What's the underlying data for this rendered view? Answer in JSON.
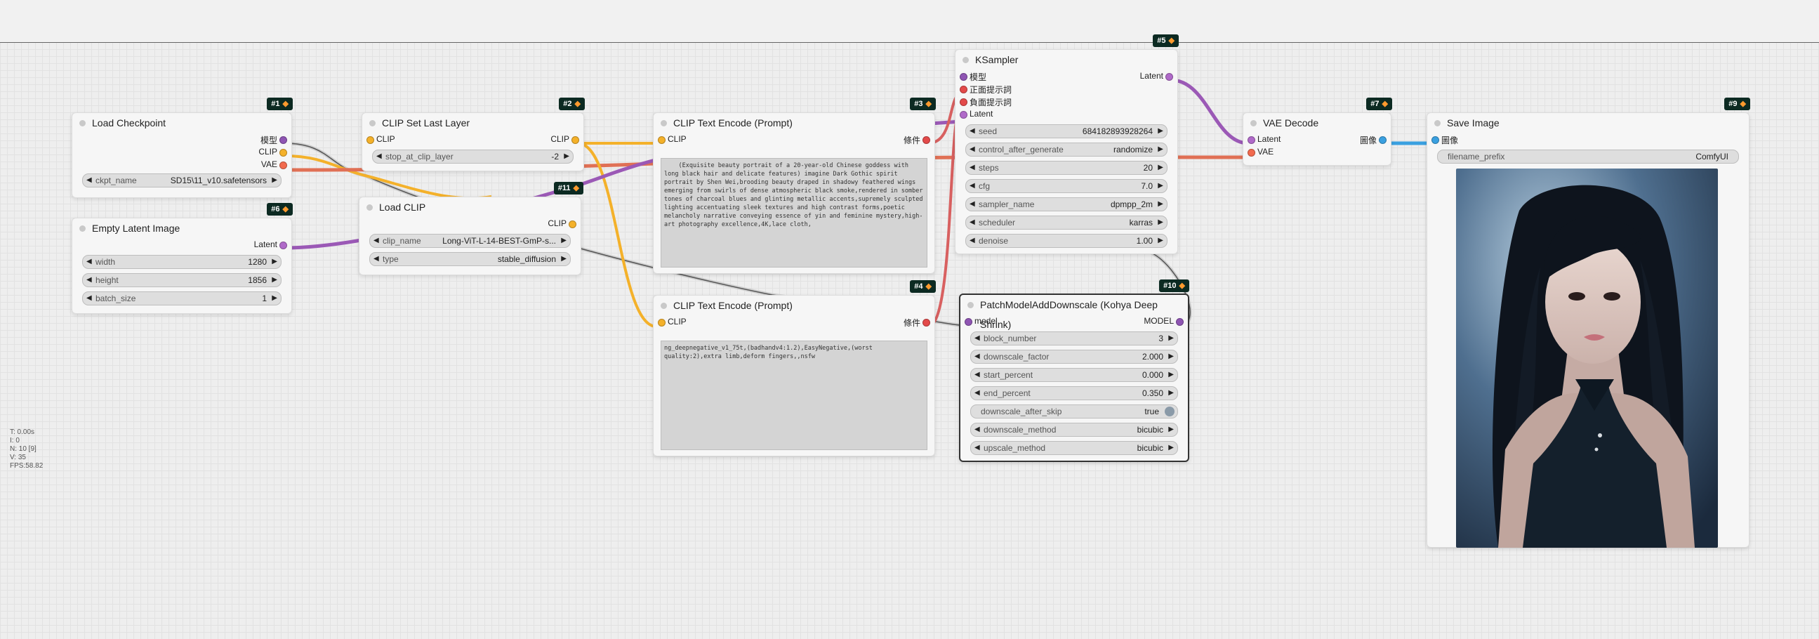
{
  "colors": {
    "model": "#8f55b3",
    "clip": "#f4b12a",
    "vae": "#f26a4e",
    "conditioning": "#e34a4a",
    "latent": "#b06ac9",
    "image": "#3aa0e0"
  },
  "stats": {
    "t": "T: 0.00s",
    "i": "I: 0",
    "n": "N: 10 [9]",
    "v": "V: 35",
    "fps": "FPS:58.82"
  },
  "nodes": {
    "n1": {
      "id": "#1",
      "title": "Load Checkpoint",
      "out_model": "模型",
      "out_clip": "CLIP",
      "out_vae": "VAE",
      "ckpt_label": "ckpt_name",
      "ckpt_value": "SD15\\11_v10.safetensors"
    },
    "n6": {
      "id": "#6",
      "title": "Empty Latent Image",
      "out_latent": "Latent",
      "w_label": "width",
      "w_value": "1280",
      "h_label": "height",
      "h_value": "1856",
      "b_label": "batch_size",
      "b_value": "1"
    },
    "n2": {
      "id": "#2",
      "title": "CLIP Set Last Layer",
      "in_clip": "CLIP",
      "out_clip": "CLIP",
      "stop_label": "stop_at_clip_layer",
      "stop_value": "-2"
    },
    "n11": {
      "id": "#11",
      "title": "Load CLIP",
      "out_clip": "CLIP",
      "name_label": "clip_name",
      "name_value": "Long-ViT-L-14-BEST-GmP-s...",
      "type_label": "type",
      "type_value": "stable_diffusion"
    },
    "n3": {
      "id": "#3",
      "title": "CLIP Text Encode (Prompt)",
      "in_clip": "CLIP",
      "out_cond": "條件",
      "text": "    (Exquisite beauty portrait of a 20-year-old Chinese goddess with long black hair and delicate features) imagine Dark Gothic spirit portrait by Shen Wei,brooding beauty draped in shadowy feathered wings emerging from swirls of dense atmospheric black smoke,rendered in somber tones of charcoal blues and glinting metallic accents,supremely sculpted lighting accentuating sleek textures and high contrast forms,poetic melancholy narrative conveying essence of yin and feminine mystery,high-art photography excellence,4K,lace cloth,"
    },
    "n4": {
      "id": "#4",
      "title": "CLIP Text Encode (Prompt)",
      "in_clip": "CLIP",
      "out_cond": "條件",
      "text": "ng_deepnegative_v1_75t,(badhandv4:1.2),EasyNegative,(worst quality:2),extra limb,deform fingers,,nsfw"
    },
    "n5": {
      "id": "#5",
      "title": "KSampler",
      "in_model": "模型",
      "in_pos": "正面提示詞",
      "in_neg": "負面提示詞",
      "in_latent": "Latent",
      "out_latent": "Latent",
      "seed_label": "seed",
      "seed_value": "684182893928264",
      "cag_label": "control_after_generate",
      "cag_value": "randomize",
      "steps_label": "steps",
      "steps_value": "20",
      "cfg_label": "cfg",
      "cfg_value": "7.0",
      "sampler_label": "sampler_name",
      "sampler_value": "dpmpp_2m",
      "sched_label": "scheduler",
      "sched_value": "karras",
      "denoise_label": "denoise",
      "denoise_value": "1.00"
    },
    "n10": {
      "id": "#10",
      "title": "PatchModelAddDownscale (Kohya Deep Shrink)",
      "in_model": "model",
      "out_model": "MODEL",
      "bn_label": "block_number",
      "bn_value": "3",
      "df_label": "downscale_factor",
      "df_value": "2.000",
      "sp_label": "start_percent",
      "sp_value": "0.000",
      "ep_label": "end_percent",
      "ep_value": "0.350",
      "das_label": "downscale_after_skip",
      "das_value": "true",
      "dm_label": "downscale_method",
      "dm_value": "bicubic",
      "um_label": "upscale_method",
      "um_value": "bicubic"
    },
    "n7": {
      "id": "#7",
      "title": "VAE Decode",
      "in_latent": "Latent",
      "in_vae": "VAE",
      "out_image": "圖像"
    },
    "n9": {
      "id": "#9",
      "title": "Save Image",
      "in_image": "圖像",
      "fp_label": "filename_prefix",
      "fp_value": "ComfyUI"
    }
  }
}
